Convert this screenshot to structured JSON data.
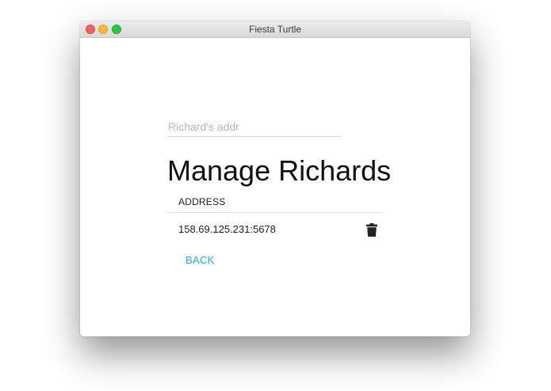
{
  "window": {
    "title": "Fiesta Turtle"
  },
  "form": {
    "address_placeholder": "Richard's addr",
    "address_value": ""
  },
  "page": {
    "title": "Manage Richards"
  },
  "table": {
    "columns": [
      "ADDRESS"
    ],
    "rows": [
      {
        "address": "158.69.125.231:5678",
        "action_icon": "trash-icon"
      }
    ]
  },
  "actions": {
    "back_label": "BACK"
  },
  "colors": {
    "accent": "#16b6d6",
    "close": "#fc5f57",
    "minimize": "#fdbb2e",
    "maximize": "#28c840"
  }
}
